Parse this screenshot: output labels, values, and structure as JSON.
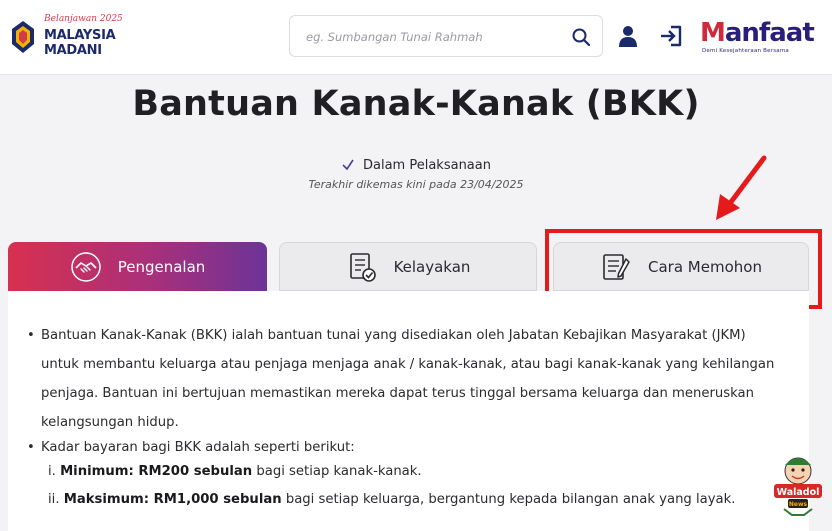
{
  "header": {
    "logo_left": {
      "tagline": "Belanjawan 2025",
      "line1": "MALAYSIA",
      "line2": "MADANI"
    },
    "search": {
      "placeholder": "eg. Sumbangan Tunai Rahmah",
      "icon": "search-icon"
    },
    "user_icon": "user-icon",
    "login_icon": "login-icon",
    "logo_right": {
      "name_first": "M",
      "name_rest": "anfaat",
      "subtitle": "Demi Kesejahteraan Bersama"
    }
  },
  "page": {
    "title": "Bantuan Kanak-Kanak (BKK)",
    "status_label": "Dalam Pelaksanaan",
    "last_updated": "Terakhir dikemas kini pada 23/04/2025"
  },
  "tabs": [
    {
      "label": "Pengenalan",
      "icon": "handshake-icon",
      "active": true
    },
    {
      "label": "Kelayakan",
      "icon": "checklist-icon",
      "active": false
    },
    {
      "label": "Cara Memohon",
      "icon": "form-pen-icon",
      "active": false
    }
  ],
  "content": {
    "bullet1": "Bantuan Kanak-Kanak (BKK) ialah bantuan tunai yang disediakan oleh Jabatan Kebajikan Masyarakat (JKM) untuk membantu keluarga atau penjaga menjaga anak / kanak-kanak, atau bagi kanak-kanak yang kehilangan penjaga. Bantuan ini bertujuan memastikan mereka dapat terus tinggal bersama keluarga dan meneruskan kelangsungan hidup.",
    "bullet2": "Kadar bayaran bagi BKK adalah seperti berikut:",
    "min_prefix": "i. ",
    "min_bold": "Minimum: RM200 sebulan",
    "min_rest": " bagi setiap kanak-kanak.",
    "max_prefix": "ii. ",
    "max_bold": "Maksimum: RM1,000 sebulan",
    "max_rest": " bagi setiap keluarga, bergantung kepada bilangan anak yang layak."
  },
  "colors": {
    "accent_start": "#d8304f",
    "accent_end": "#6d3398",
    "highlight": "#e51b1b",
    "brand_navy": "#1b2a6b"
  },
  "watermark": {
    "text": "Waladol",
    "sub": "News"
  }
}
